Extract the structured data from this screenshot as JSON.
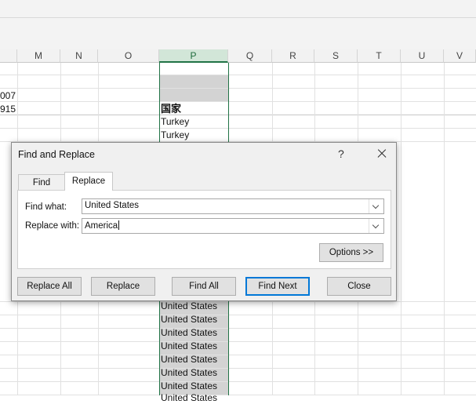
{
  "spreadsheet": {
    "columns": [
      "M",
      "N",
      "O",
      "P",
      "Q",
      "R",
      "S",
      "T",
      "U",
      "V"
    ],
    "selected_column": "P",
    "left_partial_values": [
      "007",
      "915"
    ],
    "column_p": {
      "header_cell": "国家",
      "rows_top": [
        "Turkey",
        "Turkey"
      ],
      "rows_bottom": [
        "United States",
        "United States",
        "United States",
        "United States",
        "United States",
        "United States",
        "United States",
        "United States"
      ]
    }
  },
  "dialog": {
    "title": "Find and Replace",
    "help_glyph": "?",
    "tabs": [
      {
        "label": "Find"
      },
      {
        "label": "Replace"
      }
    ],
    "active_tab": "Replace",
    "find_label": "Find what:",
    "find_value": "United States",
    "replace_label": "Replace with:",
    "replace_value": "America",
    "options_button": "Options >>",
    "buttons": {
      "replace_all": "Replace All",
      "replace": "Replace",
      "find_all": "Find All",
      "find_next": "Find Next",
      "close": "Close"
    }
  },
  "colors": {
    "accent_green": "#217346",
    "selection_gray": "#d3d3d3",
    "focus_blue": "#0078d7"
  }
}
